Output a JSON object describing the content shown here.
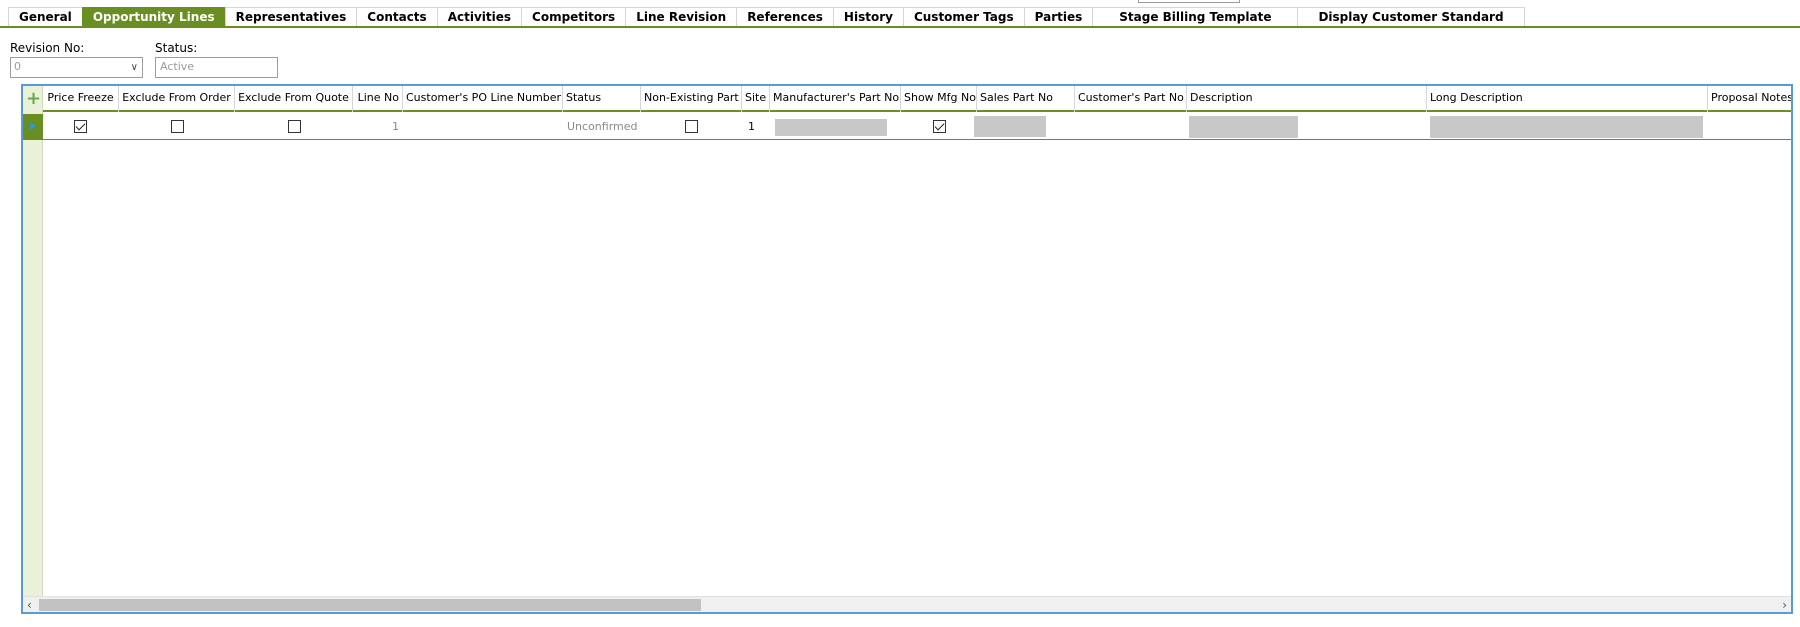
{
  "tabs": [
    {
      "label": "General",
      "active": false
    },
    {
      "label": "Opportunity Lines",
      "active": true
    },
    {
      "label": "Representatives",
      "active": false
    },
    {
      "label": "Contacts",
      "active": false
    },
    {
      "label": "Activities",
      "active": false
    },
    {
      "label": "Competitors",
      "active": false
    },
    {
      "label": "Line Revision",
      "active": false
    },
    {
      "label": "References",
      "active": false
    },
    {
      "label": "History",
      "active": false
    },
    {
      "label": "Customer Tags",
      "active": false
    },
    {
      "label": "Parties",
      "active": false
    },
    {
      "label": "Stage Billing Template",
      "active": false
    },
    {
      "label": "Display Customer Standard",
      "active": false
    }
  ],
  "form": {
    "revision_label": "Revision No:",
    "revision_value": "0",
    "status_label": "Status:",
    "status_value": "Active"
  },
  "grid": {
    "columns": [
      "Price Freeze",
      "Exclude From Order",
      "Exclude From Quote",
      "Line No",
      "Customer's PO Line Number",
      "Status",
      "Non-Existing Part",
      "Site",
      "Manufacturer's Part No",
      "Show Mfg No",
      "Sales Part No",
      "Customer's Part No",
      "Description",
      "Long Description",
      "Proposal Notes"
    ],
    "rows": [
      {
        "price_freeze": true,
        "exclude_from_order": false,
        "exclude_from_quote": false,
        "line_no": "1",
        "customer_po_line": "",
        "status": "Unconfirmed",
        "non_existing_part": false,
        "site": "1",
        "show_mfg_no": true
      }
    ]
  },
  "colors": {
    "accent": "#6b8e23",
    "grid_border": "#5b9bd5"
  },
  "icons": {
    "add": "plus-icon",
    "row": "current-row-icon",
    "dropdown": "chevron-down-icon"
  }
}
